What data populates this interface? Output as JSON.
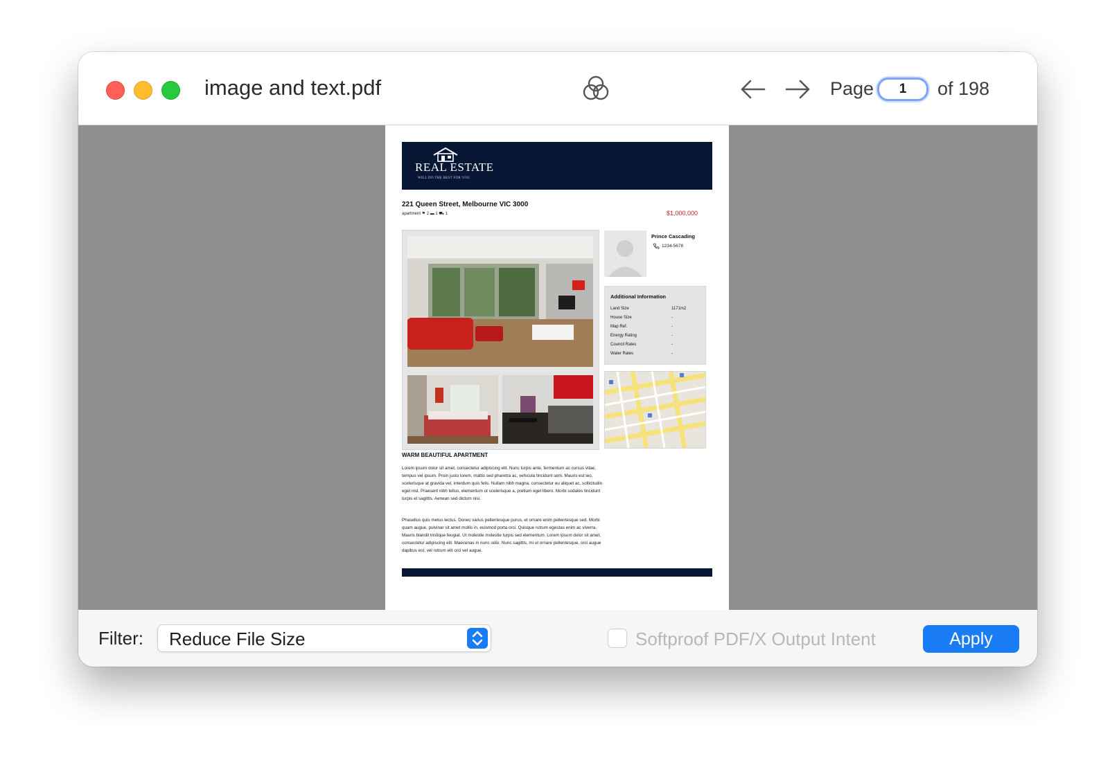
{
  "window": {
    "title": "image and text.pdf",
    "traffic_lights": [
      "close",
      "minimize",
      "zoom"
    ]
  },
  "toolbar": {
    "filter_icon": "color-filter-circles-icon",
    "back_icon": "arrow-left-icon",
    "forward_icon": "arrow-right-icon",
    "page_label": "Page",
    "page_value": "1",
    "page_total": "of 198"
  },
  "document": {
    "logo_text": "REAL ESTATE",
    "logo_tagline": "WILL DO THE BEST FOR YOU",
    "address": "221 Queen Street, Melbourne VIC 3000",
    "specs": "apartment  ⚑ 2   ▬ 1   ⛟ 1",
    "price": "$1,000,000",
    "agent_name": "Prince Cascading",
    "agent_phone": "1234-5678",
    "additional_info": {
      "title": "Additional Information",
      "rows": [
        {
          "label": "Land Size",
          "value": "1171m2"
        },
        {
          "label": "House Size",
          "value": "-"
        },
        {
          "label": "Map Ref.",
          "value": "-"
        },
        {
          "label": "Energy Rating",
          "value": "-"
        },
        {
          "label": "Council Rates",
          "value": "-"
        },
        {
          "label": "Water Rates",
          "value": "-"
        }
      ]
    },
    "description_title": "WARM BEAUTIFUL APARTMENT",
    "paragraph1": "Lorem ipsum dolor sit amet, consectetur adipiscing elit. Nunc turpis ante, fermentum ac cursus vitae, tempus vel ipsum. Proin justo lorem, mattis sed pharetra ac, vehicula tincidunt sem. Mauris est leo, scelerisque at gravida vel, interdum quis felis. Nullam nibh magna, consectetur eu aliquet ac, sollicitudin eget nisl. Praesent nibh tellus, elementum ut scelerisque a, pretium eget libero. Morbi sodales tincidunt turpis et sagittis. Aenean sed dictum nisi.",
    "paragraph2": "Phasellus quis metus lectus. Donec varius pellentesque purus, et ornare enim pellentesque sed. Morbi quam augue, pulvinar sit amet mollis in, euismod porta orci. Quisque rutrum egestas enim ac viverra. Mauris blandit tristique feugiat. Ut molestie molestie turpis sed elementum. Lorem ipsum dolor sit amet, consectetur adipiscing elit. Maecenas in nunc odio. Nunc sagittis, mi ut ornare pellentesque, orci augue dapibus est, vel rutrum elit orci vel augue."
  },
  "bottom": {
    "filter_label": "Filter:",
    "filter_value": "Reduce File Size",
    "softproof_label": "Softproof PDF/X Output Intent",
    "softproof_checked": false,
    "apply_label": "Apply"
  },
  "colors": {
    "accent": "#1a7cf5",
    "header_navy": "#061634",
    "price_red": "#c52323",
    "canvas_gray": "#8f8f8f"
  }
}
